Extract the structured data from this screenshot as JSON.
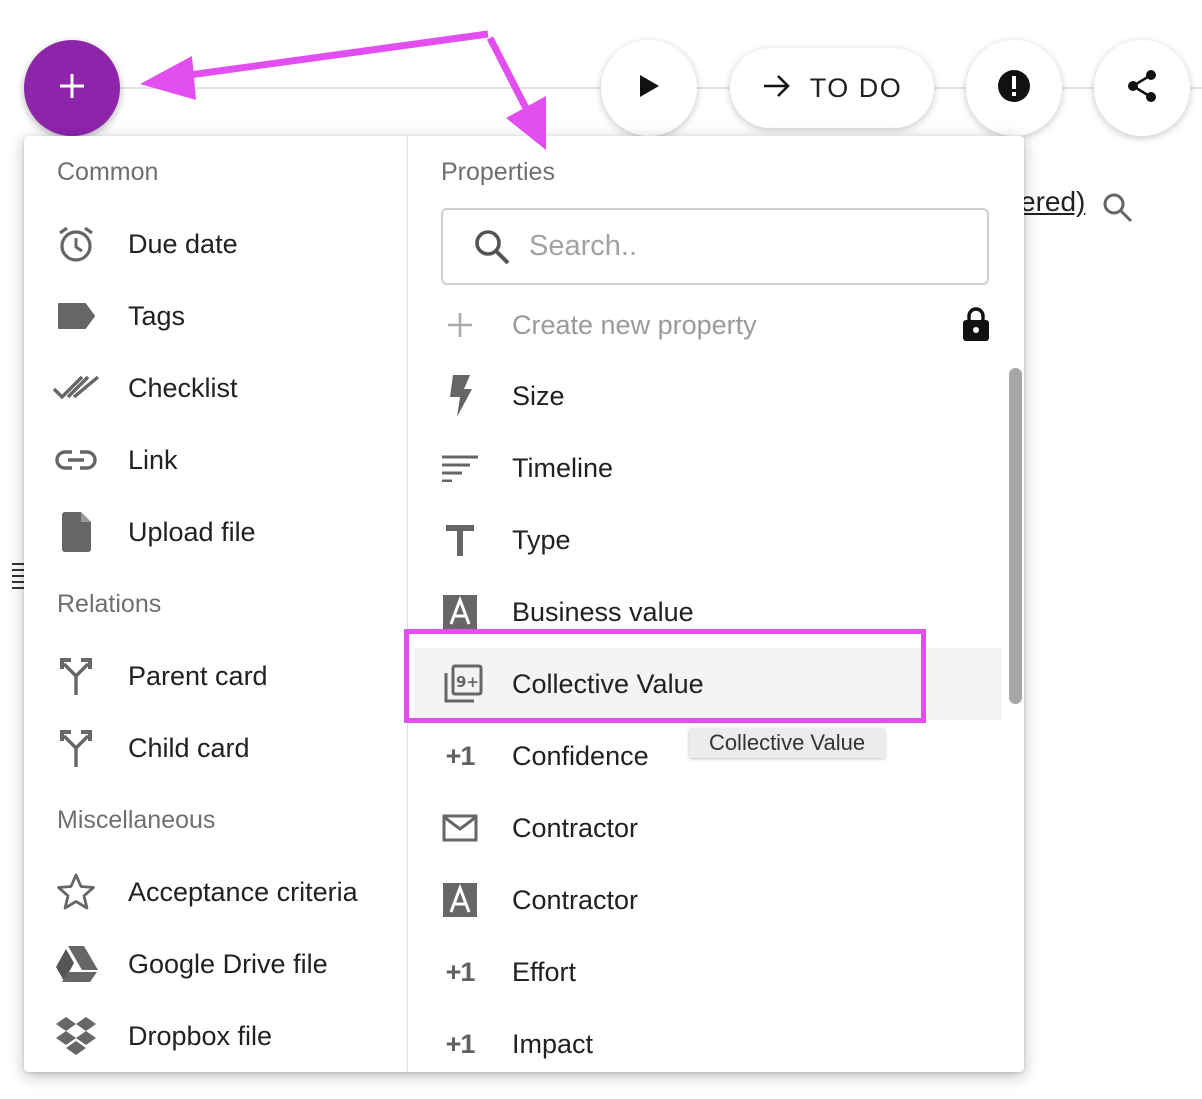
{
  "toolbar": {
    "add_button": "+",
    "status_label": "TO DO"
  },
  "background": {
    "link_fragment": "ered)"
  },
  "menu": {
    "common": {
      "title": "Common",
      "items": [
        {
          "label": "Due date",
          "icon": "alarm-clock-icon"
        },
        {
          "label": "Tags",
          "icon": "tag-icon"
        },
        {
          "label": "Checklist",
          "icon": "double-check-icon"
        },
        {
          "label": "Link",
          "icon": "link-icon"
        },
        {
          "label": "Upload file",
          "icon": "file-icon"
        }
      ]
    },
    "relations": {
      "title": "Relations",
      "items": [
        {
          "label": "Parent card",
          "icon": "merge-arrows-icon"
        },
        {
          "label": "Child card",
          "icon": "merge-arrows-icon"
        }
      ]
    },
    "misc": {
      "title": "Miscellaneous",
      "items": [
        {
          "label": "Acceptance criteria",
          "icon": "star-outline-icon"
        },
        {
          "label": "Google Drive file",
          "icon": "google-drive-icon"
        },
        {
          "label": "Dropbox file",
          "icon": "dropbox-icon"
        }
      ]
    },
    "properties": {
      "title": "Properties",
      "search_placeholder": "Search..",
      "create_label": "Create new property",
      "items": [
        {
          "label": "Size",
          "icon": "lightning-icon"
        },
        {
          "label": "Timeline",
          "icon": "sort-lines-icon"
        },
        {
          "label": "Type",
          "icon": "text-t-icon"
        },
        {
          "label": "Business value",
          "icon": "letter-a-box-icon"
        },
        {
          "label": "Collective Value",
          "icon": "nine-plus-icon"
        },
        {
          "label": "Confidence",
          "icon": "plus-one-icon",
          "icon_text": "+1"
        },
        {
          "label": "Contractor",
          "icon": "envelope-icon"
        },
        {
          "label": "Contractor",
          "icon": "letter-a-box-icon"
        },
        {
          "label": "Effort",
          "icon": "plus-one-icon",
          "icon_text": "+1"
        },
        {
          "label": "Impact",
          "icon": "plus-one-icon",
          "icon_text": "+1"
        }
      ],
      "tooltip": "Collective Value"
    }
  },
  "colors": {
    "fab": "#8e24aa",
    "annotation": "#e34ef0"
  }
}
